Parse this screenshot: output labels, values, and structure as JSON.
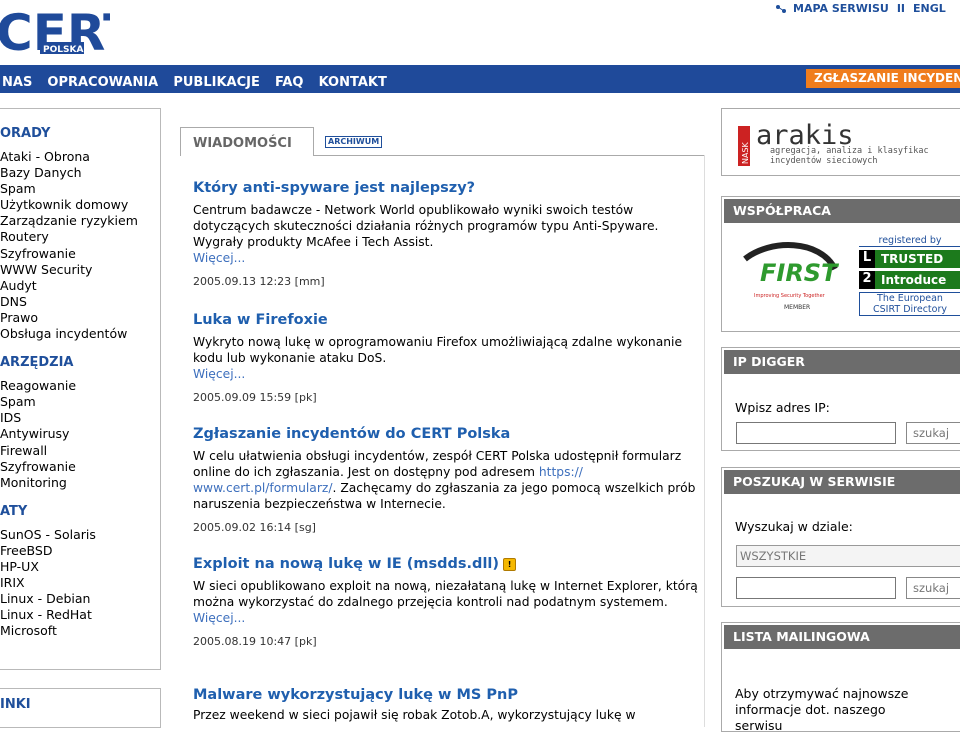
{
  "header": {
    "logo_text": "CERT",
    "logo_sub": "POLSKA",
    "sitemap_label": "MAPA SERWISU",
    "separator": "II",
    "lang_label": "ENGL"
  },
  "nav": {
    "items": [
      "NAS",
      "OPRACOWANIA",
      "PUBLIKACJE",
      "FAQ",
      "KONTAKT"
    ],
    "report_button": "ZGŁASZANIE INCYDENT"
  },
  "left": {
    "sections": [
      {
        "title": "ORADY",
        "items": [
          "Ataki - Obrona",
          "Bazy Danych",
          "Spam",
          "Użytkownik domowy",
          "Zarządzanie ryzykiem",
          "Routery",
          "Szyfrowanie",
          "WWW Security",
          "Audyt",
          "DNS",
          "Prawo",
          "Obsługa incydentów"
        ]
      },
      {
        "title": "ARZĘDZIA",
        "items": [
          "Reagowanie",
          "Spam",
          "IDS",
          "Antywirusy",
          "Firewall",
          "Szyfrowanie",
          "Monitoring"
        ]
      },
      {
        "title": "ATY",
        "items": [
          "SunOS - Solaris",
          "FreeBSD",
          "HP-UX",
          "IRIX",
          "Linux - Debian",
          "Linux - RedHat",
          "Microsoft"
        ]
      }
    ],
    "links_title": "INKI"
  },
  "news": {
    "tab_label": "WIADOMOŚCI",
    "archive_label": "ARCHIWUM",
    "more_label": "Więcej...",
    "articles": [
      {
        "title": "Który anti-spyware jest najlepszy?",
        "body": "Centrum badawcze - Network World opublikowało wyniki swoich testów dotyczących skuteczności działania różnych programów typu Anti-Spyware. Wygrały produkty McAfee i Tech Assist.",
        "date": "2005.09.13 12:23 [mm]"
      },
      {
        "title": "Luka w Firefoxie",
        "body": "Wykryto nową lukę w oprogramowaniu Firefox umożliwiającą zdalne wykonanie kodu lub wykonanie ataku DoS.",
        "date": "2005.09.09 15:59 [pk]"
      },
      {
        "title": "Zgłaszanie incydentów do CERT Polska",
        "body_pre": "W celu ułatwienia obsługi incydentów, zespół CERT Polska udostępnił formularz online do ich zgłaszania. Jest on dostępny pod adresem ",
        "body_link": "https:// www.cert.pl/formularz/",
        "body_post": ". Zachęcamy do zgłaszania za jego pomocą wszelkich prób naruszenia bezpieczeństwa w Internecie.",
        "date": "2005.09.02 16:14 [sg]"
      },
      {
        "title": "Exploit na nową lukę w IE (msdds.dll)",
        "body": "W sieci opublikowano exploit na nową, niezałataną lukę w Internet Explorer, którą można wykorzystać do zdalnego przejęcia kontroli nad podatnym systemem.",
        "date": "2005.08.19 10:47 [pk]"
      },
      {
        "title": "Malware wykorzystujący lukę w MS PnP",
        "body": "Przez weekend w sieci pojawił się robak Zotob.A, wykorzystujący lukę w"
      }
    ]
  },
  "right": {
    "arakis": {
      "name": "arakis",
      "side_text": "NASK",
      "tagline": "agregacja, analiza i klasyfikac incydentów sieciowych"
    },
    "cooperation": {
      "title": "WSPÓŁPRACA",
      "first_label": "FIRST",
      "first_tagline": "Improving Security Together",
      "first_member": "MEMBER",
      "ti_registered": "registered by",
      "ti_trusted": "TRUSTED",
      "ti_introducer": "Introduce",
      "ti_europe": "The European",
      "ti_directory": "CSIRT Directory"
    },
    "ip_digger": {
      "title": "IP DIGGER",
      "label": "Wpisz adres IP:",
      "button": "szukaj"
    },
    "site_search": {
      "title": "POSZUKAJ W SERWISIE",
      "label": "Wyszukaj w dziale:",
      "select_value": "WSZYSTKIE",
      "button": "szukaj"
    },
    "mailing": {
      "title": "LISTA MAILINGOWA",
      "text": "Aby otrzymywać najnowsze informacje dot. naszego serwisu"
    }
  }
}
